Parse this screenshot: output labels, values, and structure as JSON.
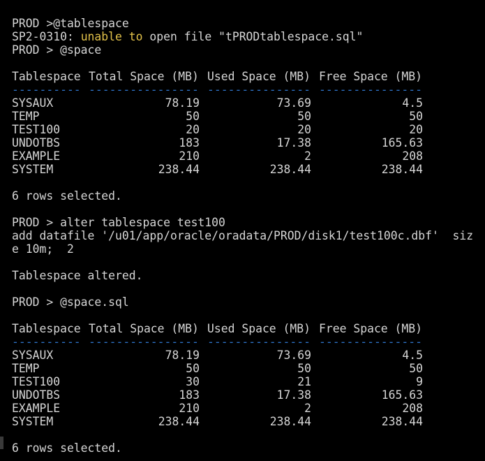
{
  "lines": {
    "l1": "PROD >@tablespace",
    "l2_prefix": "SP2-0310:",
    "l2_hl1": "unable",
    "l2_hl2": "to",
    "l2_suffix": "open file \"tPRODtablespace.sql\"",
    "l3": "PROD > @space",
    "rows_selected": "6 rows selected.",
    "cmd_alter": "PROD > alter tablespace test100",
    "cmd_add": "add datafile '/u01/app/oracle/oradata/PROD/disk1/test100c.dbf'  siz",
    "cmd_cont": "e 10m;  2",
    "altered": "Tablespace altered.",
    "cmd_space": "PROD > @space.sql"
  },
  "table_headers": [
    "Tablespace",
    "Total Space (MB)",
    "Used Space (MB)",
    "Free Space (MB)"
  ],
  "dash_segments": [
    "----------",
    "----------------",
    "---------------",
    "---------------"
  ],
  "table1": [
    [
      "SYSAUX",
      "78.19",
      "73.69",
      "4.5"
    ],
    [
      "TEMP",
      "50",
      "50",
      "50"
    ],
    [
      "TEST100",
      "20",
      "20",
      "20"
    ],
    [
      "UNDOTBS",
      "183",
      "17.38",
      "165.63"
    ],
    [
      "EXAMPLE",
      "210",
      "2",
      "208"
    ],
    [
      "SYSTEM",
      "238.44",
      "238.44",
      "238.44"
    ]
  ],
  "table2": [
    [
      "SYSAUX",
      "78.19",
      "73.69",
      "4.5"
    ],
    [
      "TEMP",
      "50",
      "50",
      "50"
    ],
    [
      "TEST100",
      "30",
      "21",
      "9"
    ],
    [
      "UNDOTBS",
      "183",
      "17.38",
      "165.63"
    ],
    [
      "EXAMPLE",
      "210",
      "2",
      "208"
    ],
    [
      "SYSTEM",
      "238.44",
      "238.44",
      "238.44"
    ]
  ],
  "colors": {
    "background": "#000000",
    "text": "#d6d6d6",
    "dash_blue": "#2e73c8",
    "highlight_yellow": "#e3c24a"
  }
}
